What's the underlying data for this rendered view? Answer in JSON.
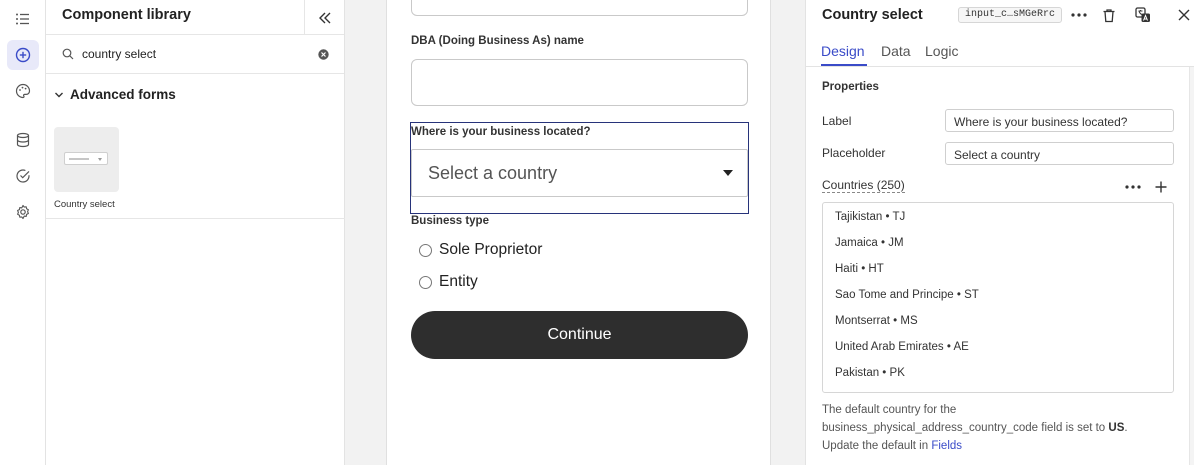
{
  "rail": {
    "items": [
      {
        "icon": "list-icon"
      },
      {
        "icon": "add-circle-icon",
        "active": true
      },
      {
        "icon": "palette-icon"
      },
      {
        "icon": "database-icon"
      },
      {
        "icon": "check-circle-icon"
      },
      {
        "icon": "gear-icon"
      }
    ]
  },
  "library": {
    "title": "Component library",
    "search_value": "country select",
    "section_title": "Advanced forms",
    "card_label": "Country select"
  },
  "form": {
    "dba_label": "DBA (Doing Business As) name",
    "location_label": "Where is your business located?",
    "select_placeholder": "Select a country",
    "business_type_label": "Business type",
    "radio_options": [
      "Sole Proprietor",
      "Entity"
    ],
    "continue_label": "Continue"
  },
  "panel": {
    "title": "Country select",
    "component_id": "input_c…sMGeRrc",
    "tabs": [
      "Design",
      "Data",
      "Logic"
    ],
    "active_tab": "Design",
    "section_title": "Properties",
    "label_label": "Label",
    "label_value": "Where is your business located?",
    "placeholder_label": "Placeholder",
    "placeholder_value": "Select a country",
    "countries_label": "Countries (250)",
    "countries": [
      "Tajikistan • TJ",
      "Jamaica • JM",
      "Haiti • HT",
      "Sao Tome and Principe • ST",
      "Montserrat • MS",
      "United Arab Emirates • AE",
      "Pakistan • PK"
    ],
    "help_text_1": "The default country for the",
    "help_text_2": "business_physical_address_country_code field is set to",
    "help_bold": "US",
    "help_text_3": "Update the default in",
    "help_link": "Fields"
  },
  "colors": {
    "accent": "#3a4bc8",
    "selection_outline": "#27337a",
    "button_dark": "#2e2e2e"
  }
}
